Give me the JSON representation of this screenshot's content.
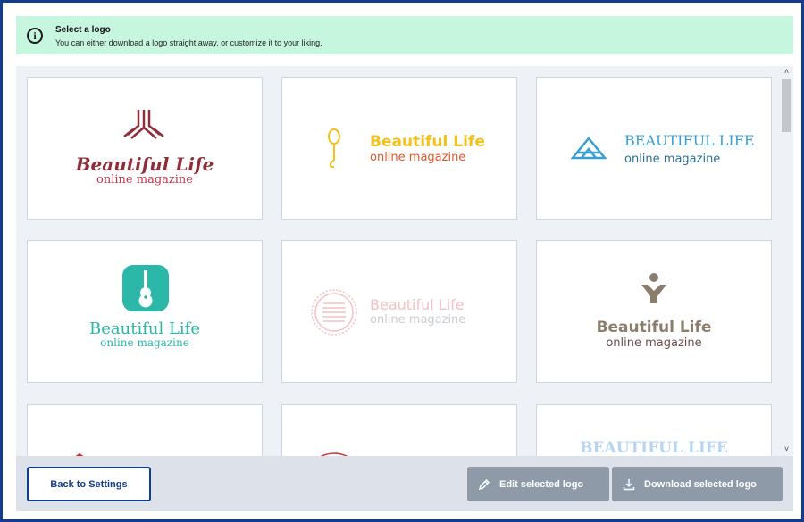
{
  "info": {
    "title": "Select a logo",
    "message": "You can either download a logo straight away, or customize it to your liking.",
    "icon": "info-icon"
  },
  "logos": [
    {
      "title": "Beautiful Life",
      "subtitle": "online magazine",
      "icon": "tripod-icon",
      "title_color": "#8c2f3b",
      "subtitle_color": "#c2334d"
    },
    {
      "title": "Beautiful Life",
      "subtitle": "online magazine",
      "icon": "microphone-icon",
      "title_color": "#f2c21b",
      "subtitle_color": "#e2572b"
    },
    {
      "title": "BEAUTIFUL LIFE",
      "subtitle": "online magazine",
      "icon": "mountain-triangle-icon",
      "title_color": "#3a9fd0",
      "subtitle_color": "#2d6f95"
    },
    {
      "title": "Beautiful Life",
      "subtitle": "online magazine",
      "icon": "guitar-icon",
      "title_color": "#2bb8a8",
      "subtitle_color": "#2bb8a8"
    },
    {
      "title": "Beautiful Life",
      "subtitle": "online magazine",
      "icon": "stacked-circle-icon",
      "title_color": "#f3c1c4",
      "subtitle_color": "#c9cdd1"
    },
    {
      "title": "Beautiful Life",
      "subtitle": "online magazine",
      "icon": "person-figure-icon",
      "title_color": "#8b7d6b",
      "subtitle_color": "#6b4f4f"
    },
    {
      "title": "",
      "subtitle": "",
      "icon": "red-shape-icon"
    },
    {
      "title": "",
      "subtitle": "",
      "icon": "red-arc-icon"
    },
    {
      "title": "BEAUTIFUL LIFE",
      "subtitle": "",
      "icon": "",
      "title_color": "#b8d4f0"
    }
  ],
  "footer": {
    "back_label": "Back to Settings",
    "edit_label": "Edit selected logo",
    "download_label": "Download selected logo"
  },
  "colors": {
    "accent": "#123c8c",
    "banner": "#c6f6de",
    "button_gray": "#8e9aa8"
  }
}
